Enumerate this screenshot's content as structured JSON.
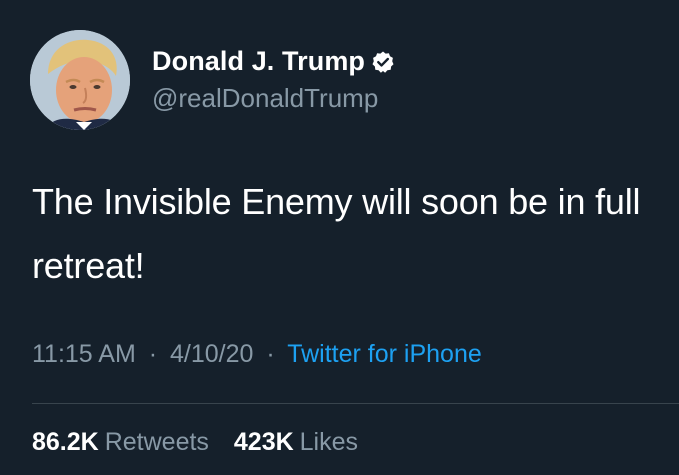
{
  "tweet": {
    "author": {
      "display_name": "Donald J. Trump",
      "handle": "@realDonaldTrump",
      "verified_icon": "verified-badge-icon",
      "avatar": "profile-photo"
    },
    "text": "The Invisible Enemy will soon be in full retreat!",
    "time": "11:15 AM",
    "separator_1": "·",
    "date": "4/10/20",
    "separator_2": "·",
    "source": "Twitter for iPhone",
    "stats": {
      "retweets_count": "86.2K",
      "retweets_label": "Retweets",
      "likes_count": "423K",
      "likes_label": "Likes"
    }
  },
  "colors": {
    "background": "#15202b",
    "primary_text": "#ffffff",
    "secondary_text": "#8899a6",
    "link": "#1da1f2",
    "divider": "#38444d"
  }
}
